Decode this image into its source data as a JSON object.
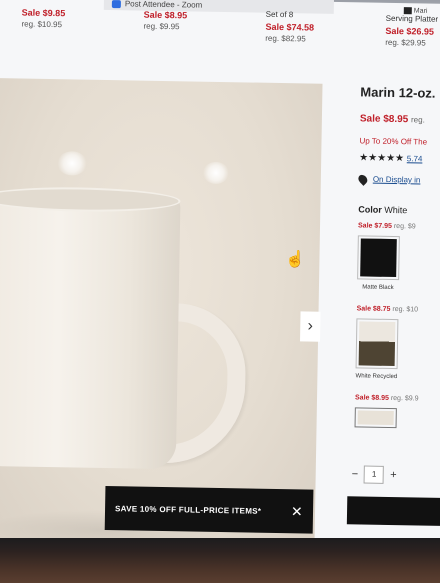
{
  "window": {
    "zoom_title": "Post Attendee - Zoom",
    "right_label": "Mari"
  },
  "strip": [
    {
      "sale": "Sale $9.85",
      "reg": "reg. $10.95"
    },
    {
      "sale": "Sale $8.95",
      "reg": "reg. $9.95"
    },
    {
      "top": "Set of 8",
      "sale": "Sale $74.58",
      "reg": "reg. $82.95"
    },
    {
      "top": "Serving Platter",
      "sale": "Sale $26.95",
      "reg": "reg. $29.95"
    }
  ],
  "product": {
    "title": "Marin 12-oz.",
    "sale": "Sale $8.95",
    "reg": "reg.",
    "promo": "Up To 20% Off The",
    "stars": "★★★★★",
    "reviews": "5.74",
    "display": "On Display in",
    "color_label": "Color",
    "color_value": "White"
  },
  "swatches": [
    {
      "sale": "Sale $7.95",
      "reg": "reg. $9",
      "name": "Matte Black",
      "color": "#111111"
    },
    {
      "sale": "Sale $8.75",
      "reg": "reg. $10",
      "name": "White Recycled",
      "color": "#4e4433"
    },
    {
      "sale": "Sale $8.95",
      "reg": "reg. $9.9",
      "name": "",
      "color": "#e8e2d8"
    }
  ],
  "quantity": {
    "minus": "−",
    "value": "1",
    "plus": "+"
  },
  "banner": {
    "text": "SAVE 10% OFF FULL-PRICE ITEMS*",
    "close": "✕"
  },
  "carousel": {
    "next": "›"
  }
}
